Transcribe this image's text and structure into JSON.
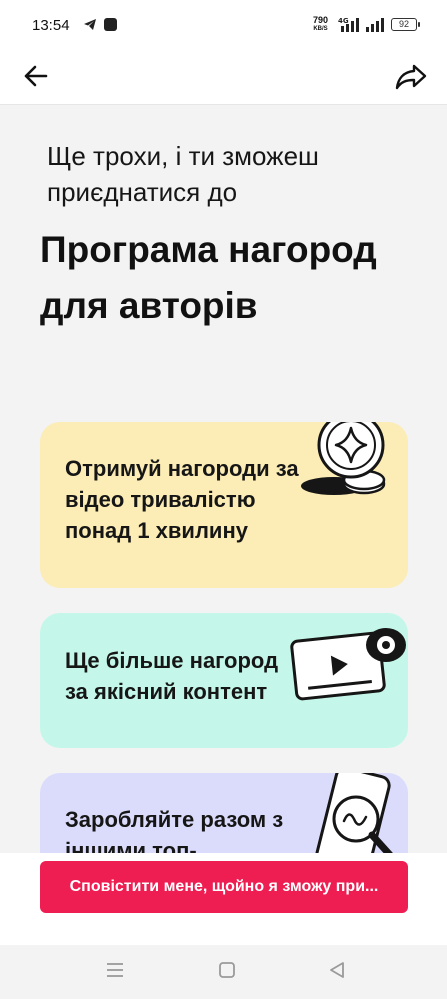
{
  "status_bar": {
    "time": "13:54",
    "net_speed_value": "790",
    "net_speed_unit": "KB/S",
    "network_type": "4G",
    "battery": "92"
  },
  "header": {
    "back_icon": "arrow-left-icon",
    "share_icon": "share-arrow-icon"
  },
  "intro": "Ще трохи, і ти зможеш приєднатися до",
  "title": "Програма нагород для авторів",
  "cards": [
    {
      "text": "Отримуй нагороди за відео тривалістю понад 1 хвилину",
      "color": "#fcecb5",
      "icon": "coin-icon"
    },
    {
      "text": "Ще більше нагород за якісний контент",
      "color": "#c4f7e9",
      "icon": "video-player-icon"
    },
    {
      "text": "Заробляйте разом з іншими топ-",
      "color": "#dbdcfb",
      "icon": "phone-magnifier-icon"
    }
  ],
  "cta": {
    "label": "Сповістити мене, щойно я зможу при...",
    "color": "#ee1d52"
  },
  "nav": {
    "menu_icon": "menu-lines-icon",
    "home_icon": "square-home-icon",
    "back_icon": "triangle-back-icon"
  }
}
